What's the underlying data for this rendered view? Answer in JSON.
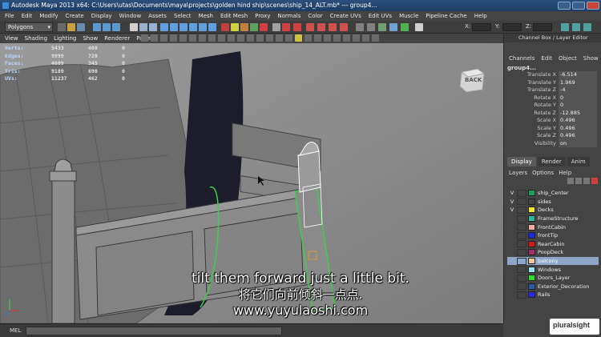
{
  "window": {
    "title": "Autodesk Maya 2013 x64: C:\\Users\\utas\\Documents\\maya\\projects\\golden hind ship\\scenes\\ship_14_ALT.mb*  ---  group4..."
  },
  "menubar": [
    "File",
    "Edit",
    "Modify",
    "Create",
    "Display",
    "Window",
    "Assets",
    "Select",
    "Mesh",
    "Edit Mesh",
    "Proxy",
    "Normals",
    "Color",
    "Create UVs",
    "Edit UVs",
    "Muscle",
    "Pipeline Cache",
    "Help"
  ],
  "status_line": {
    "mode": "Polygons",
    "x_label": "X:",
    "y_label": "Y:",
    "z_label": "Z:"
  },
  "viewport_menu": [
    "View",
    "Shading",
    "Lighting",
    "Show",
    "Renderer",
    "Panels"
  ],
  "hud": [
    {
      "label": "Verts:",
      "v1": "5433",
      "v2": "408",
      "v3": "0"
    },
    {
      "label": "Edges:",
      "v1": "9999",
      "v2": "720",
      "v3": "0"
    },
    {
      "label": "Faces:",
      "v1": "4609",
      "v2": "345",
      "v3": "0"
    },
    {
      "label": "Tris:",
      "v1": "9189",
      "v2": "690",
      "v3": "0"
    },
    {
      "label": "UVs:",
      "v1": "11237",
      "v2": "462",
      "v3": "0"
    }
  ],
  "view_cube": "BACK",
  "subtitle": {
    "en": "tilt them forward just a little bit.",
    "zh": "将它们向前倾斜一点点.",
    "url": "www.yuyulaoshi.com"
  },
  "command_line": {
    "label": "MEL"
  },
  "channel_box": {
    "title": "Channel Box / Layer Editor",
    "menu": [
      "Channels",
      "Edit",
      "Object",
      "Show"
    ],
    "object": "group4...",
    "attributes": [
      {
        "name": "Translate X",
        "value": "-6.514"
      },
      {
        "name": "Translate Y",
        "value": "1.969"
      },
      {
        "name": "Translate Z",
        "value": "-4"
      },
      {
        "name": "Rotate X",
        "value": "0"
      },
      {
        "name": "Rotate Y",
        "value": "0"
      },
      {
        "name": "Rotate Z",
        "value": "-12.885"
      },
      {
        "name": "Scale X",
        "value": "0.496"
      },
      {
        "name": "Scale Y",
        "value": "0.496"
      },
      {
        "name": "Scale Z",
        "value": "0.496"
      },
      {
        "name": "Visibility",
        "value": "on"
      }
    ]
  },
  "layer_editor": {
    "tabs": [
      "Display",
      "Render",
      "Anim"
    ],
    "menu": [
      "Layers",
      "Options",
      "Help"
    ],
    "layers": [
      {
        "name": "ship_Center",
        "visible": "V",
        "color": "#1aa05a"
      },
      {
        "name": "sides",
        "visible": "V",
        "color": "#444444"
      },
      {
        "name": "Decks",
        "visible": "V",
        "color": "#f0e62a"
      },
      {
        "name": "FrameStructure",
        "visible": "",
        "color": "#2ab8a0"
      },
      {
        "name": "FrontCabin",
        "visible": "",
        "color": "#f0b0a0"
      },
      {
        "name": "frontTip",
        "visible": "",
        "color": "#1a2ae0"
      },
      {
        "name": "RearCabin",
        "visible": "",
        "color": "#d01a1a"
      },
      {
        "name": "PoopDeck",
        "visible": "",
        "color": "#a0306a"
      },
      {
        "name": "balcony",
        "visible": "",
        "color": "#f0c8a0",
        "selected": true
      },
      {
        "name": "Windows",
        "visible": "",
        "color": "#9adfee"
      },
      {
        "name": "Doors_Layer",
        "visible": "",
        "color": "#2ae02a"
      },
      {
        "name": "Exterior_Decoration",
        "visible": "",
        "color": "#2a5aa0"
      },
      {
        "name": "Rails",
        "visible": "",
        "color": "#2a2ae0"
      }
    ]
  },
  "logo": "pluralsight"
}
